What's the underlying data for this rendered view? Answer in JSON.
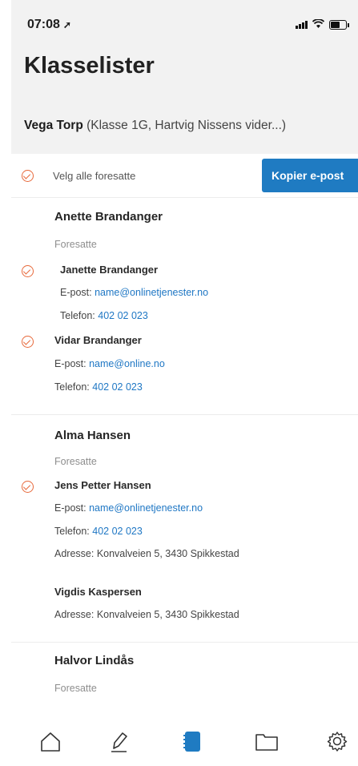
{
  "status": {
    "time": "07:08",
    "location_icon": "location-arrow-icon"
  },
  "header": {
    "title": "Klasselister"
  },
  "pupil": {
    "name": "Vega Torp",
    "class_info": "(Klasse 1G, Hartvig Nissens vider...)"
  },
  "actions": {
    "select_all_label": "Velg alle foresatte",
    "copy_email_label": "Kopier e-post"
  },
  "labels": {
    "role": "Foresatte",
    "email_prefix": "E-post: ",
    "phone_prefix": "Telefon: ",
    "address_prefix": "Adresse: "
  },
  "students": [
    {
      "name": "Anette Brandanger",
      "guardians": [
        {
          "name": "Janette Brandanger",
          "email": "name@onlinetjenester.no",
          "phone": "402 02 023",
          "selected": true
        },
        {
          "name": "Vidar Brandanger",
          "email": "name@online.no",
          "phone": "402 02 023",
          "selected": true
        }
      ]
    },
    {
      "name": "Alma Hansen",
      "guardians": [
        {
          "name": "Jens Petter Hansen",
          "email": "name@onlinetjenester.no",
          "phone": "402 02 023",
          "address": "Konvalveien 5, 3430 Spikkestad",
          "selected": true
        },
        {
          "name": "Vigdis Kaspersen",
          "address": "Konvalveien 5, 3430 Spikkestad",
          "selected": false
        }
      ]
    },
    {
      "name": "Halvor Lindås",
      "guardians": []
    }
  ],
  "tabbar": {
    "items": [
      "home-icon",
      "pen-icon",
      "notebook-icon",
      "folder-icon",
      "settings-icon"
    ],
    "active_index": 2
  },
  "colors": {
    "accent": "#1f7bc2",
    "check": "#e7693b",
    "link": "#1f77c4",
    "header_bg": "#f2f2f2"
  }
}
